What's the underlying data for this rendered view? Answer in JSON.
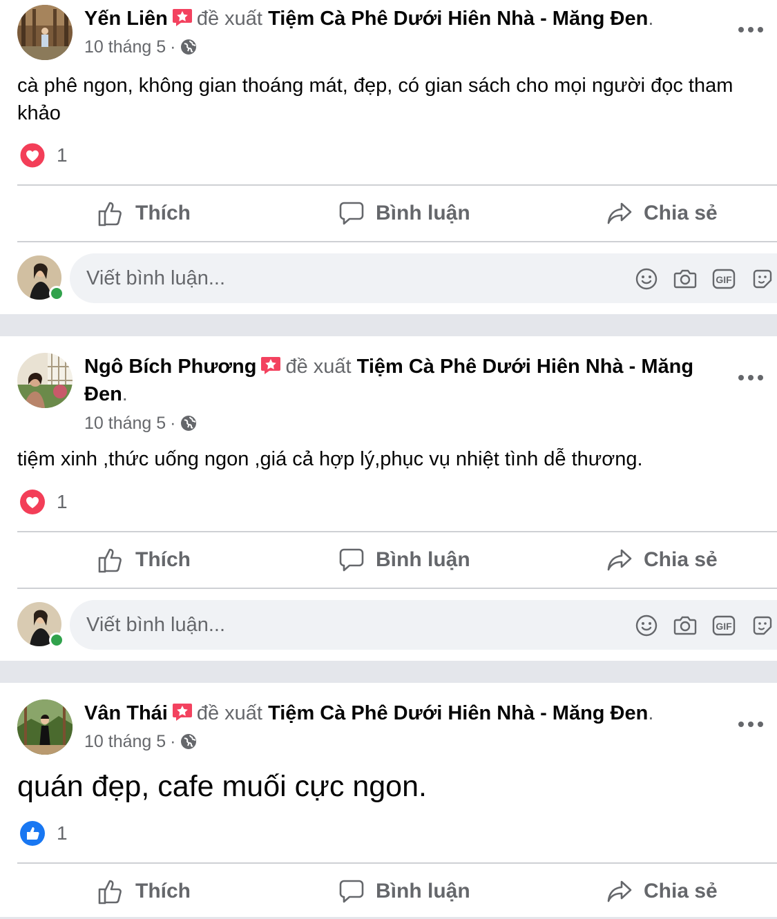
{
  "posts": [
    {
      "author": "Yến Liên",
      "verb": "đề xuất",
      "page": "Tiệm Cà Phê Dưới Hiên Nhà - Măng Đen",
      "end": ".",
      "date": "10 tháng 5",
      "separator": "·",
      "text": "cà phê ngon, không gian thoáng mát, đẹp, có gian sách cho mọi người đọc tham khảo",
      "reaction_type": "love",
      "reaction_count": "1"
    },
    {
      "author": "Ngô Bích Phương",
      "verb": "đề xuất",
      "page": "Tiệm Cà Phê Dưới Hiên Nhà - Măng Đen",
      "end": ".",
      "date": "10 tháng 5",
      "separator": "·",
      "text": "tiệm xinh ,thức uống ngon ,giá cả hợp lý,phục vụ nhiệt tình dễ thương.",
      "reaction_type": "love",
      "reaction_count": "1"
    },
    {
      "author": "Vân Thái",
      "verb": "đề xuất",
      "page": "Tiệm Cà Phê Dưới Hiên Nhà - Măng Đen",
      "end": ".",
      "date": "10 tháng 5",
      "separator": "·",
      "text": "quán đẹp, cafe muối cực ngon.",
      "reaction_type": "like",
      "reaction_count": "1"
    }
  ],
  "actions": {
    "like": "Thích",
    "comment": "Bình luận",
    "share": "Chia sẻ"
  },
  "comment_placeholder": "Viết bình luận...",
  "icons": {
    "gif_label": "GIF"
  },
  "colors": {
    "love": "#f33e58",
    "like": "#1877f2",
    "secondary_text": "#65676b",
    "online": "#31a24c"
  }
}
